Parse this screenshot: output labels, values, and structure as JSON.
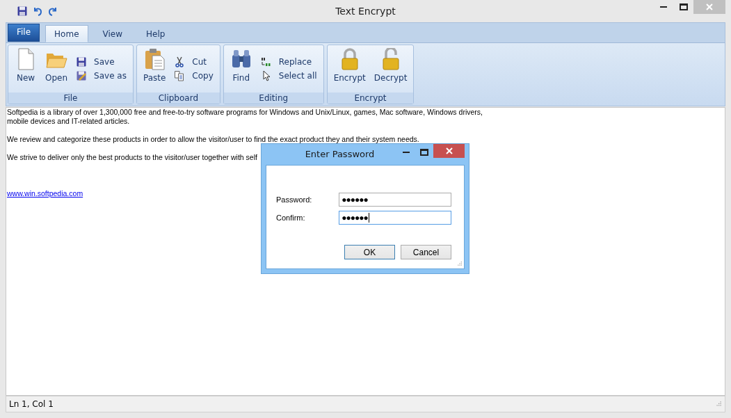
{
  "window": {
    "title": "Text Encrypt"
  },
  "tabs": [
    {
      "label": "File",
      "kind": "app",
      "selected": false
    },
    {
      "label": "Home",
      "kind": "tab",
      "selected": true
    },
    {
      "label": "View",
      "kind": "tab",
      "selected": false
    },
    {
      "label": "Help",
      "kind": "tab",
      "selected": false
    }
  ],
  "ribbon_groups": [
    {
      "label": "File",
      "items": [
        {
          "label": "New",
          "kind": "large"
        },
        {
          "label": "Open",
          "kind": "large"
        },
        {
          "label": "Save",
          "kind": "small"
        },
        {
          "label": "Save as",
          "kind": "small"
        }
      ]
    },
    {
      "label": "Clipboard",
      "items": [
        {
          "label": "Paste",
          "kind": "large"
        },
        {
          "label": "Cut",
          "kind": "small"
        },
        {
          "label": "Copy",
          "kind": "small"
        }
      ]
    },
    {
      "label": "Editing",
      "items": [
        {
          "label": "Find",
          "kind": "large"
        },
        {
          "label": "Replace",
          "kind": "small"
        },
        {
          "label": "Select all",
          "kind": "small"
        }
      ]
    },
    {
      "label": "Encrypt",
      "items": [
        {
          "label": "Encrypt",
          "kind": "large"
        },
        {
          "label": "Decrypt",
          "kind": "large"
        }
      ]
    }
  ],
  "document": {
    "paragraphs": [
      "Softpedia is a library of over 1,300,000 free and free-to-try software programs for Windows and Unix/Linux, games, Mac software, Windows drivers, mobile devices and IT-related articles.",
      "We review and categorize these products in order to allow the visitor/user to find the exact product they and their system needs.",
      "We strive to deliver only the best products to the visitor/user together with self"
    ],
    "link": "www.win.softpedia.com"
  },
  "dialog": {
    "title": "Enter Password",
    "fields": [
      {
        "label": "Password:",
        "value": "●●●●●●",
        "focused": false
      },
      {
        "label": "Confirm:",
        "value": "●●●●●●",
        "focused": true
      }
    ],
    "buttons": [
      {
        "label": "OK",
        "default": true
      },
      {
        "label": "Cancel",
        "default": false
      }
    ]
  },
  "status_bar": {
    "text": "Ln 1, Col 1"
  }
}
